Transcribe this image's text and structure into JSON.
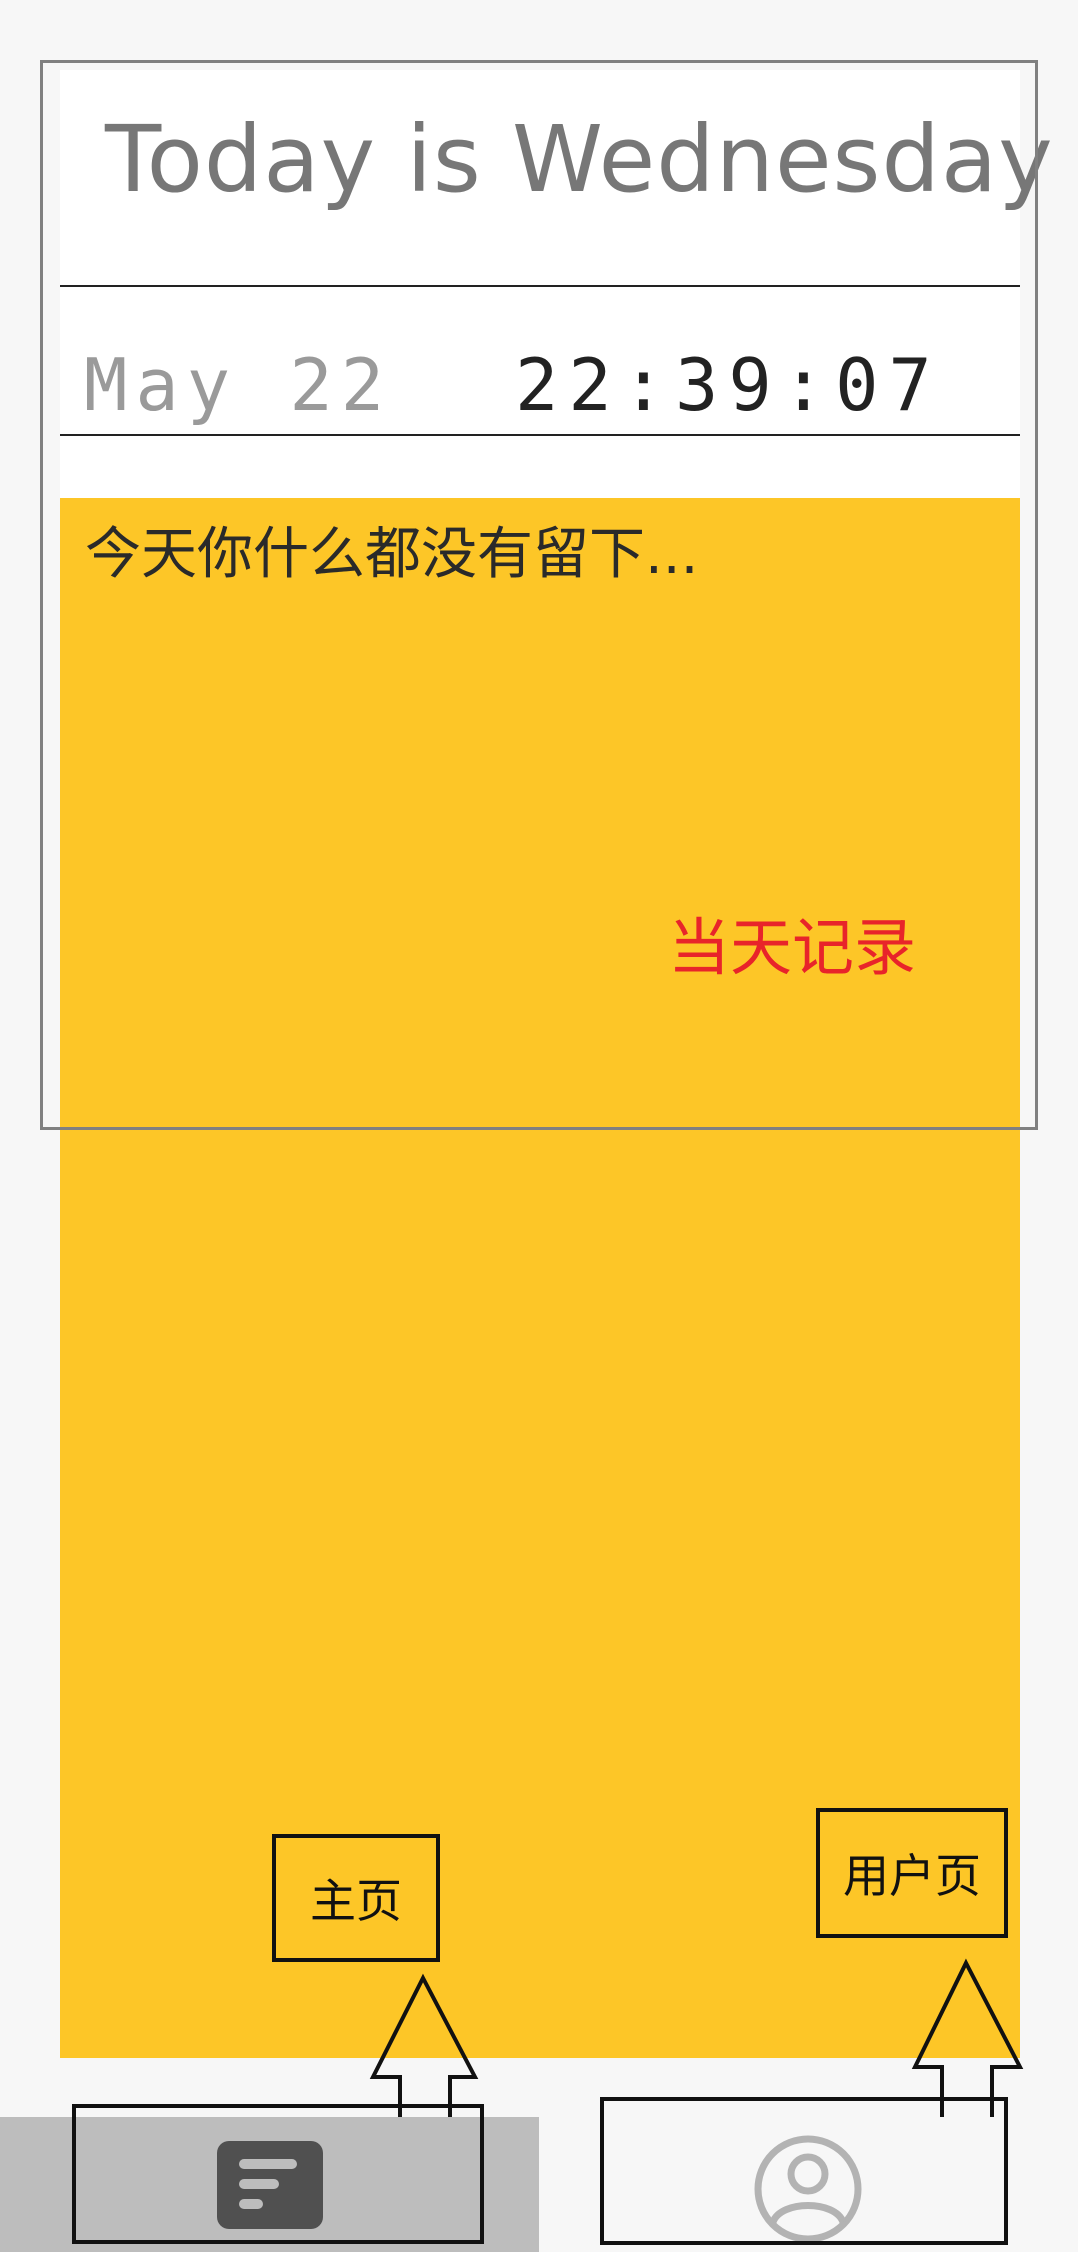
{
  "header": {
    "title": "Today is Wednesday",
    "date": "May 22",
    "time": "22:39:07"
  },
  "note": {
    "empty_text": "今天你什么都没有留下..."
  },
  "annotations": {
    "today_record": "当天记录",
    "home_label": "主页",
    "user_label": "用户页"
  },
  "nav": {
    "tabs": [
      {
        "id": "home",
        "icon": "notes-icon",
        "active": true
      },
      {
        "id": "user",
        "icon": "user-profile-icon",
        "active": false
      }
    ]
  },
  "colors": {
    "note_background": "#fdc627",
    "annotation_red": "#e8242a",
    "active_tab": "#bdbdbd"
  }
}
